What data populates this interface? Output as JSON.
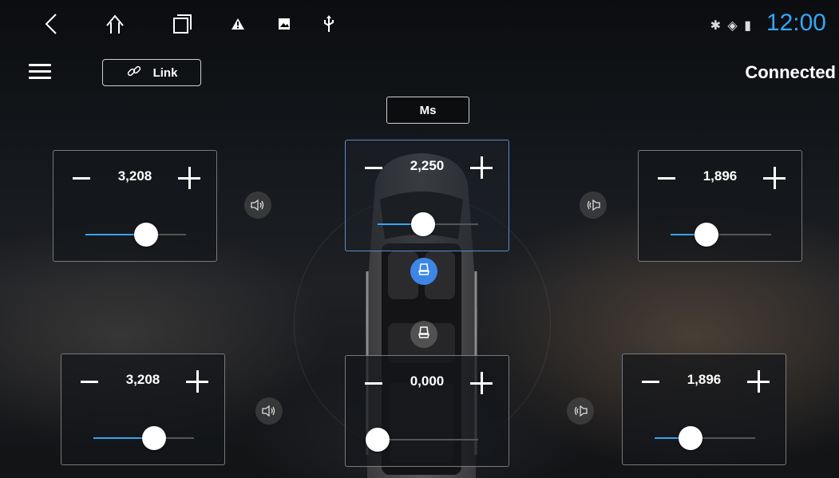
{
  "statusbar": {
    "clock": "12:00",
    "icons": [
      "back-icon",
      "home-icon",
      "recents-icon",
      "warning-icon",
      "image-icon",
      "usb-icon",
      "bluetooth-icon",
      "wifi-icon",
      "battery-icon"
    ]
  },
  "header": {
    "link_label": "Link",
    "connection_status": "Connected",
    "mode_label": "Ms"
  },
  "channels": [
    {
      "id": "front-left",
      "value": "3,208",
      "level": 0.6
    },
    {
      "id": "center-top",
      "value": "2,250",
      "level": 0.45
    },
    {
      "id": "front-right",
      "value": "1,896",
      "level": 0.36
    },
    {
      "id": "rear-left",
      "value": "3,208",
      "level": 0.6
    },
    {
      "id": "center-bottom",
      "value": "0,000",
      "level": 0.0
    },
    {
      "id": "rear-right",
      "value": "1,896",
      "level": 0.36
    }
  ],
  "colors": {
    "accent": "#35a5f2",
    "seat_active": "#3d86e8",
    "clock": "#34a7f5"
  }
}
